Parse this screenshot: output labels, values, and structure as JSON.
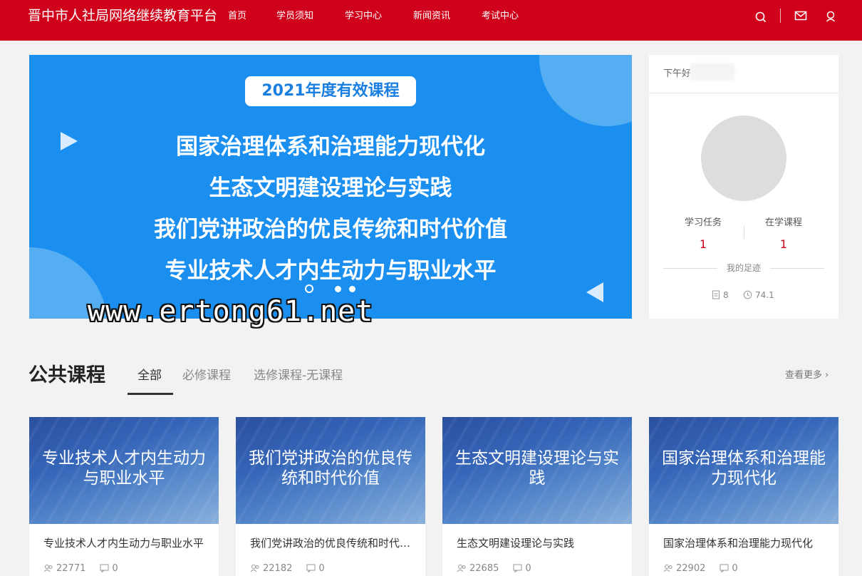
{
  "header": {
    "site_title": "晋中市人社局网络继续教育平台",
    "nav": [
      "首页",
      "学员须知",
      "学习中心",
      "新闻资讯",
      "考试中心"
    ],
    "icons": [
      "search-icon",
      "mail-icon",
      "user-icon"
    ],
    "brand_color": "#d0021b"
  },
  "banner": {
    "pill": "2021年度有效课程",
    "lines": [
      "国家治理体系和治理能力现代化",
      "生态文明建设理论与实践",
      "我们党讲政治的优良传统和时代价值",
      "专业技术人才内生动力与职业水平"
    ],
    "watermark": "www.ertong61.net",
    "color": "#1a8ff0"
  },
  "user": {
    "greeting": "下午好",
    "stats": [
      {
        "label": "学习任务",
        "value": "1"
      },
      {
        "label": "在学课程",
        "value": "1"
      }
    ],
    "footprint_label": "我的足迹",
    "doc_count": "8",
    "hours": "74.1"
  },
  "section": {
    "title": "公共课程",
    "tabs": [
      "全部",
      "必修课程",
      "选修课程-无课程"
    ],
    "more": "查看更多 ›"
  },
  "courses": [
    {
      "cover": "专业技术人才内生动力与职业水平",
      "title": "专业技术人才内生动力与职业水平",
      "learners": "22771",
      "comments": "0"
    },
    {
      "cover": "我们党讲政治的优良传统和时代价值",
      "title": "我们党讲政治的优良传统和时代价值",
      "learners": "22182",
      "comments": "0"
    },
    {
      "cover": "生态文明建设理论与实践",
      "title": "生态文明建设理论与实践",
      "learners": "22685",
      "comments": "0"
    },
    {
      "cover": "国家治理体系和治理能力现代化",
      "title": "国家治理体系和治理能力现代化",
      "learners": "22902",
      "comments": "0"
    }
  ]
}
